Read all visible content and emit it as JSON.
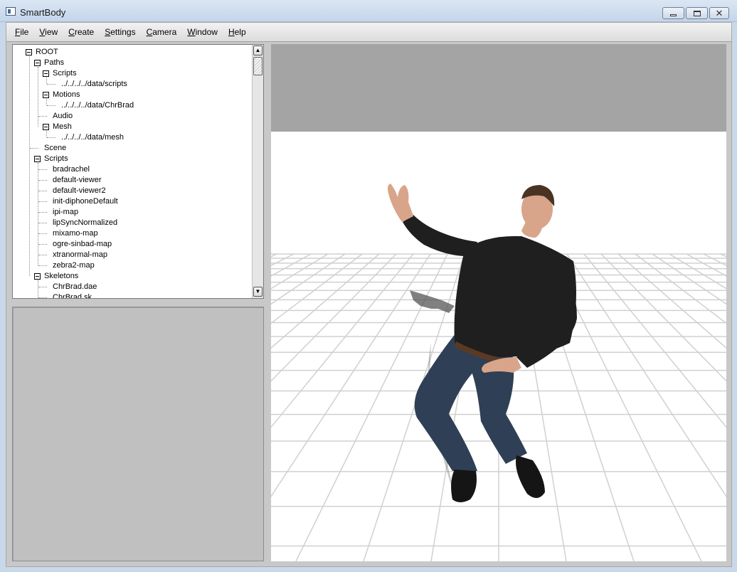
{
  "window": {
    "title": "SmartBody"
  },
  "menu": [
    {
      "accel": "F",
      "rest": "ile"
    },
    {
      "accel": "V",
      "rest": "iew"
    },
    {
      "accel": "C",
      "rest": "reate"
    },
    {
      "accel": "S",
      "rest": "ettings"
    },
    {
      "accel": "C",
      "rest": "amera"
    },
    {
      "accel": "W",
      "rest": "indow"
    },
    {
      "accel": "H",
      "rest": "elp"
    }
  ],
  "tree": [
    {
      "label": "ROOT",
      "depth": 0,
      "expanded": true
    },
    {
      "label": "Paths",
      "depth": 1,
      "expanded": true
    },
    {
      "label": "Scripts",
      "depth": 2,
      "expanded": true
    },
    {
      "label": "../../../../data/scripts",
      "depth": 3
    },
    {
      "label": "Motions",
      "depth": 2,
      "expanded": true
    },
    {
      "label": "../../../../data/ChrBrad",
      "depth": 3
    },
    {
      "label": "Audio",
      "depth": 2
    },
    {
      "label": "Mesh",
      "depth": 2,
      "expanded": true
    },
    {
      "label": "../../../../data/mesh",
      "depth": 3
    },
    {
      "label": "Scene",
      "depth": 1
    },
    {
      "label": "Scripts",
      "depth": 1,
      "expanded": true
    },
    {
      "label": "bradrachel",
      "depth": 2
    },
    {
      "label": "default-viewer",
      "depth": 2
    },
    {
      "label": "default-viewer2",
      "depth": 2
    },
    {
      "label": "init-diphoneDefault",
      "depth": 2
    },
    {
      "label": "ipi-map",
      "depth": 2
    },
    {
      "label": "lipSyncNormalized",
      "depth": 2
    },
    {
      "label": "mixamo-map",
      "depth": 2
    },
    {
      "label": "ogre-sinbad-map",
      "depth": 2
    },
    {
      "label": "xtranormal-map",
      "depth": 2
    },
    {
      "label": "zebra2-map",
      "depth": 2
    },
    {
      "label": "Skeletons",
      "depth": 1,
      "expanded": true
    },
    {
      "label": "ChrBrad.dae",
      "depth": 2
    },
    {
      "label": "ChrBrad.sk",
      "depth": 2
    }
  ],
  "viewport": {
    "colors": {
      "sky": "#a4a4a4",
      "floor": "#ffffff",
      "grid": "#d0d0d0",
      "shirt": "#1f1f1f",
      "jeans": "#2f3f55",
      "skin": "#d8a58a",
      "hair": "#4a3322",
      "shoes": "#151515"
    }
  }
}
